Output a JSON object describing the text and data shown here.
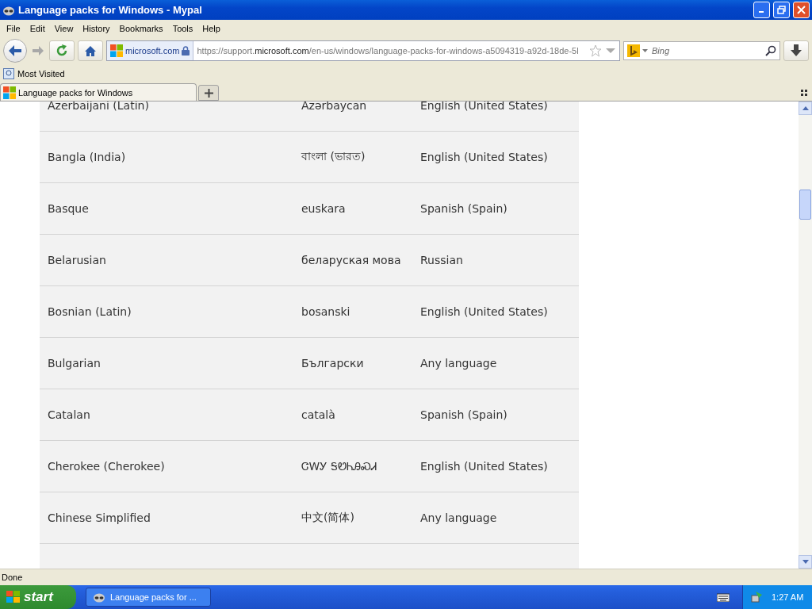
{
  "window": {
    "title": "Language packs for Windows - Mypal"
  },
  "menu": [
    "File",
    "Edit",
    "View",
    "History",
    "Bookmarks",
    "Tools",
    "Help"
  ],
  "address_bar": {
    "site": "microsoft.com",
    "url_prefix": "https://support.",
    "url_domain": "microsoft.com",
    "url_path": "/en-us/windows/language-packs-for-windows-a5094319-a92d-18de-5l"
  },
  "search": {
    "placeholder": "Bing"
  },
  "bookmarks": [
    "Most Visited"
  ],
  "tabs": [
    {
      "label": "Language packs for Windows",
      "selected": true
    }
  ],
  "table": {
    "rows": [
      {
        "language": "Azerbaijani (Latin)",
        "native": "Azərbaycan",
        "base": "English (United States)"
      },
      {
        "language": "Bangla (India)",
        "native": "বাংলা (ভারত)",
        "base": "English (United States)"
      },
      {
        "language": "Basque",
        "native": "euskara",
        "base": "Spanish (Spain)"
      },
      {
        "language": "Belarusian",
        "native": "беларуская мова",
        "base": "Russian"
      },
      {
        "language": "Bosnian (Latin)",
        "native": "bosanski",
        "base": "English (United States)"
      },
      {
        "language": "Bulgarian",
        "native": "Български",
        "base": "Any language"
      },
      {
        "language": "Catalan",
        "native": "català",
        "base": "Spanish (Spain)"
      },
      {
        "language": "Cherokee (Cherokee)",
        "native": "ᏣᎳᎩ ᎦᏬᏂᎯᏍᏗ",
        "base": "English (United States)"
      },
      {
        "language": "Chinese Simplified",
        "native": "中文(简体)",
        "base": "Any language"
      }
    ]
  },
  "status_bar": "Done",
  "taskbar": {
    "start": "start",
    "tasks": [
      {
        "label": "Language packs for ...",
        "selected": false
      }
    ],
    "clock": "1:27 AM"
  }
}
